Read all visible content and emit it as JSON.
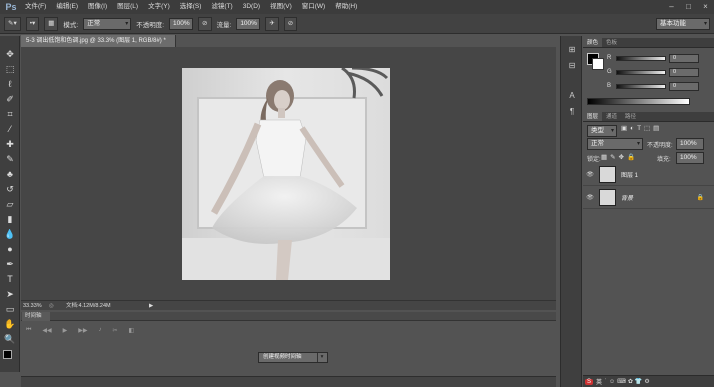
{
  "app": {
    "logo": "Ps",
    "menu": [
      "文件(F)",
      "编辑(E)",
      "图像(I)",
      "图层(L)",
      "文字(Y)",
      "选择(S)",
      "滤镜(T)",
      "3D(D)",
      "视图(V)",
      "窗口(W)",
      "帮助(H)"
    ]
  },
  "options": {
    "mode_label": "模式:",
    "mode_value": "正常",
    "opacity_label": "不透明度:",
    "opacity_value": "100%",
    "flow_label": "流量:",
    "flow_value": "100%",
    "workspace": "基本功能"
  },
  "document": {
    "tab_title": "5-3 调出低饱和色调.jpg @ 33.3% (图层 1, RGB/8#) *",
    "zoom": "33.33%",
    "doc_size": "文档:4.12M/8.24M"
  },
  "timeline": {
    "tab": "时间轴",
    "create_button": "创建视频时间轴"
  },
  "color_panel": {
    "tabs": [
      "颜色",
      "色板"
    ],
    "channels": [
      {
        "name": "R",
        "value": "0"
      },
      {
        "name": "G",
        "value": "0"
      },
      {
        "name": "B",
        "value": "0"
      }
    ]
  },
  "layers_panel": {
    "tabs": [
      "图层",
      "通道",
      "路径"
    ],
    "kind_filter": "类型",
    "blend_mode": "正常",
    "opacity_label": "不透明度:",
    "opacity_value": "100%",
    "lock_label": "锁定:",
    "fill_label": "填充:",
    "fill_value": "100%",
    "layers": [
      {
        "name": "图层 1",
        "visible": true,
        "selected": false
      },
      {
        "name": "背景",
        "visible": true,
        "selected": false,
        "locked": true
      }
    ]
  },
  "taskbar": {
    "ime": "英"
  }
}
